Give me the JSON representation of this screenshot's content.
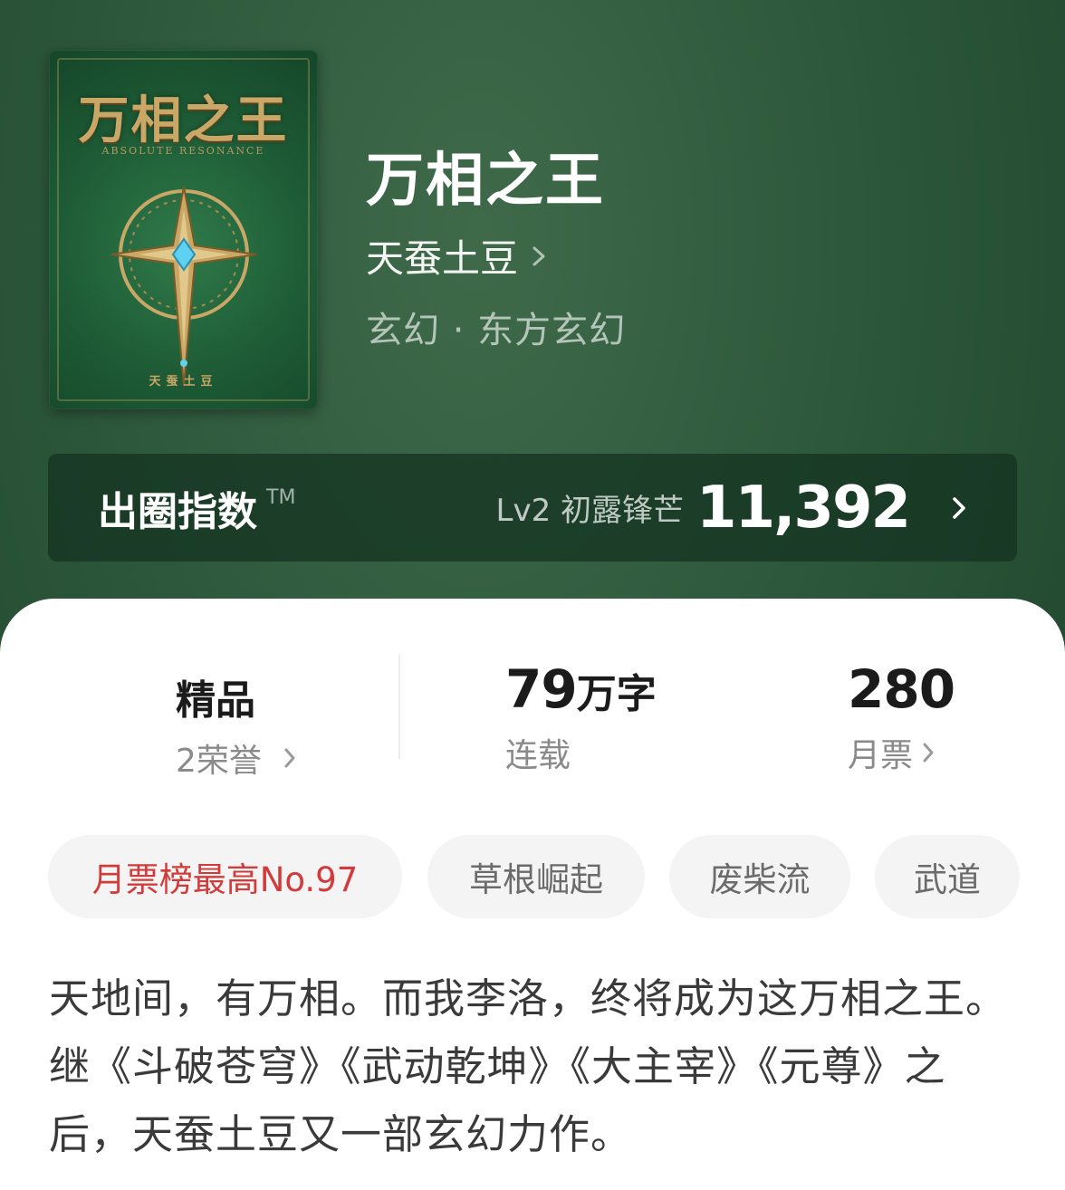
{
  "book": {
    "title": "万相之王",
    "author": "天蚕土豆",
    "genre": "玄幻 · 东方玄幻",
    "cover": {
      "title_art": "万相之王",
      "subtitle_art": "ABSOLUTE RESONANCE",
      "author_art": "天蚕土豆",
      "colors": {
        "background": "#1d5a35",
        "gold": "#c9a766",
        "gem": "#5fd0f0"
      }
    }
  },
  "index": {
    "label": "出圈指数",
    "tm": "TM",
    "level": "Lv2 初露锋芒",
    "value": "11,392"
  },
  "stats": [
    {
      "main": "精品",
      "sub": "2荣誉"
    },
    {
      "main": "79",
      "unit": "万字",
      "sub": "连载"
    },
    {
      "main": "280",
      "sub": "月票"
    }
  ],
  "tags": [
    "月票榜最高No.97",
    "草根崛起",
    "废柴流",
    "武道"
  ],
  "description": "天地间，有万相。而我李洛，终将成为这万相之王。继《斗破苍穹》《武动乾坤》《大主宰》《元尊》之后，天蚕土豆又一部玄幻力作。",
  "colors": {
    "header_bg": "#2f5a3d",
    "accent_red": "#d23b3b",
    "tag_bg": "#f4f4f4"
  },
  "icons": {
    "author_link": "chevron-right-icon",
    "index_link": "chevron-right-icon"
  }
}
